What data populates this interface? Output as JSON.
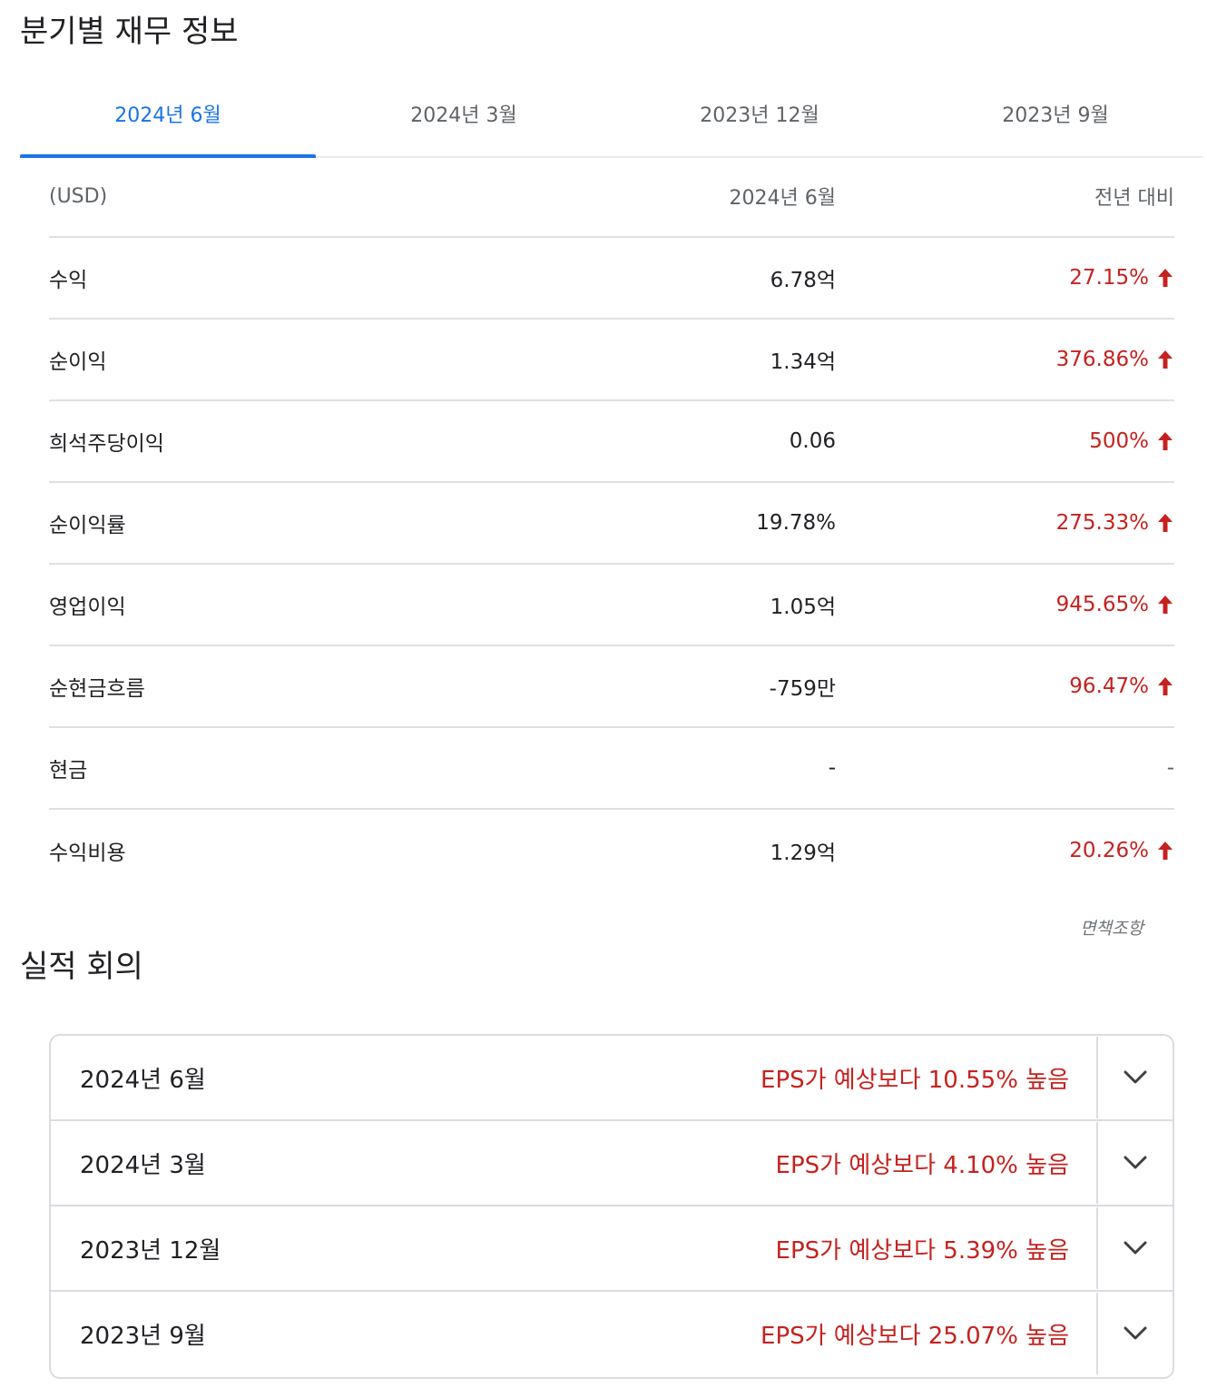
{
  "financials": {
    "title": "분기별 재무 정보",
    "tabs": [
      "2024년 6월",
      "2024년 3월",
      "2023년 12월",
      "2023년 9월"
    ],
    "active_tab": 0,
    "header": {
      "unit": "(USD)",
      "period": "2024년 6월",
      "change": "전년 대비"
    },
    "rows": [
      {
        "label": "수익",
        "value": "6.78억",
        "change": "27.15%",
        "direction": "up"
      },
      {
        "label": "순이익",
        "value": "1.34억",
        "change": "376.86%",
        "direction": "up"
      },
      {
        "label": "희석주당이익",
        "value": "0.06",
        "change": "500%",
        "direction": "up"
      },
      {
        "label": "순이익률",
        "value": "19.78%",
        "change": "275.33%",
        "direction": "up"
      },
      {
        "label": "영업이익",
        "value": "1.05억",
        "change": "945.65%",
        "direction": "up"
      },
      {
        "label": "순현금흐름",
        "value": "-759만",
        "change": "96.47%",
        "direction": "up"
      },
      {
        "label": "현금",
        "value": "-",
        "change": "-",
        "direction": "none"
      },
      {
        "label": "수익비용",
        "value": "1.29억",
        "change": "20.26%",
        "direction": "up"
      }
    ],
    "disclaimer": "면책조항"
  },
  "earnings": {
    "title": "실적 회의",
    "items": [
      {
        "date": "2024년 6월",
        "result": "EPS가 예상보다 10.55% 높음"
      },
      {
        "date": "2024년 3월",
        "result": "EPS가 예상보다 4.10% 높음"
      },
      {
        "date": "2023년 12월",
        "result": "EPS가 예상보다 5.39% 높음"
      },
      {
        "date": "2023년 9월",
        "result": "EPS가 예상보다 25.07% 높음"
      }
    ]
  },
  "colors": {
    "accent": "#1a73e8",
    "positive_change": "#c5221f",
    "muted": "#5f6368"
  }
}
